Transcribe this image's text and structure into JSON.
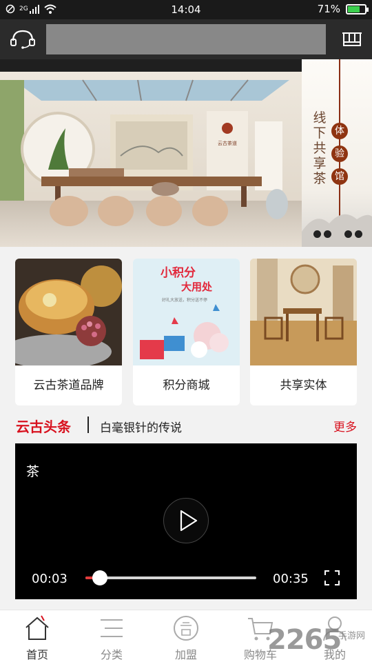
{
  "status_bar": {
    "time": "14:04",
    "battery": "71%",
    "battery_level": 0.71,
    "network": "2G"
  },
  "header": {
    "search_placeholder": ""
  },
  "banner": {
    "vertical_text": "线下共享茶",
    "badges": [
      "体",
      "验",
      "馆"
    ],
    "sign_text": "云古茶道"
  },
  "cards": [
    {
      "label": "云古茶道品牌"
    },
    {
      "label": "积分商城",
      "image_title": "小积分",
      "image_title2": "大用处",
      "image_caption": "好礼大放送，积分送不停"
    },
    {
      "label": "共享实体"
    }
  ],
  "news": {
    "brand": "云古头条",
    "headline": "白毫银针的传说",
    "more": "更多"
  },
  "video": {
    "title": "茶",
    "current_time": "00:03",
    "duration": "00:35",
    "progress": 0.086
  },
  "tabbar": {
    "items": [
      {
        "label": "首页",
        "icon": "home-icon"
      },
      {
        "label": "分类",
        "icon": "menu-icon"
      },
      {
        "label": "加盟",
        "icon": "join-icon"
      },
      {
        "label": "购物车",
        "icon": "cart-icon"
      },
      {
        "label": "我的",
        "icon": "user-icon"
      }
    ]
  },
  "watermark": {
    "number": "2265",
    "text": "手游网"
  },
  "colors": {
    "accent_red": "#d8121f",
    "header_bg": "#2b2b2b",
    "badge_brown": "#8f3411"
  }
}
